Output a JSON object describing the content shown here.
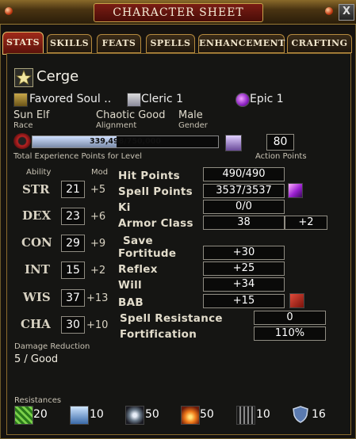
{
  "window": {
    "title": "CHARACTER SHEET",
    "close_label": "X"
  },
  "tabs": [
    {
      "label": "STATS",
      "active": true
    },
    {
      "label": "SKILLS"
    },
    {
      "label": "FEATS"
    },
    {
      "label": "SPELLS"
    },
    {
      "label": "ENHANCEMENT"
    },
    {
      "label": "CRAFTING"
    }
  ],
  "character": {
    "name": "Cerge",
    "class_primary": "Favored Soul ..",
    "class_secondary": "Cleric 1",
    "class_epic": "Epic 1",
    "race": "Sun Elf",
    "race_label": "Race",
    "alignment": "Chaotic Good",
    "alignment_label": "Alignment",
    "gender": "Male",
    "gender_label": "Gender"
  },
  "experience": {
    "text": "339,498/750,000",
    "fraction": 0.4527,
    "caption": "Total Experience Points for Level",
    "action_points": "80",
    "action_points_label": "Action Points"
  },
  "abilities_header": {
    "ability": "Ability",
    "mod": "Mod"
  },
  "abilities": [
    {
      "name": "STR",
      "value": "21",
      "mod": "+5"
    },
    {
      "name": "DEX",
      "value": "23",
      "mod": "+6"
    },
    {
      "name": "CON",
      "value": "29",
      "mod": "+9"
    },
    {
      "name": "INT",
      "value": "15",
      "mod": "+2"
    },
    {
      "name": "WIS",
      "value": "37",
      "mod": "+13"
    },
    {
      "name": "CHA",
      "value": "30",
      "mod": "+10"
    }
  ],
  "stats": {
    "hp_label": "Hit Points",
    "hp": "490/490",
    "sp_label": "Spell Points",
    "sp": "3537/3537",
    "ki_label": "Ki",
    "ki": "0/0",
    "ac_label": "Armor Class",
    "ac": "38",
    "ac_bonus": "+2",
    "save_label": "Save",
    "fort_label": "Fortitude",
    "fort": "+30",
    "reflex_label": "Reflex",
    "reflex": "+25",
    "will_label": "Will",
    "will": "+34",
    "bab_label": "BAB",
    "bab": "+15",
    "sr_label": "Spell Resistance",
    "sr": "0",
    "fortification_label": "Fortification",
    "fortification": "110%"
  },
  "damage_reduction": {
    "label": "Damage Reduction",
    "value": "5 / Good"
  },
  "resistances": {
    "label": "Resistances",
    "items": [
      {
        "icon": "acid-icon",
        "value": "20"
      },
      {
        "icon": "cold-icon",
        "value": "10"
      },
      {
        "icon": "electric-icon",
        "value": "50"
      },
      {
        "icon": "fire-icon",
        "value": "50"
      },
      {
        "icon": "sonic-icon",
        "value": "10"
      },
      {
        "icon": "shield-icon",
        "value": "16"
      }
    ]
  }
}
